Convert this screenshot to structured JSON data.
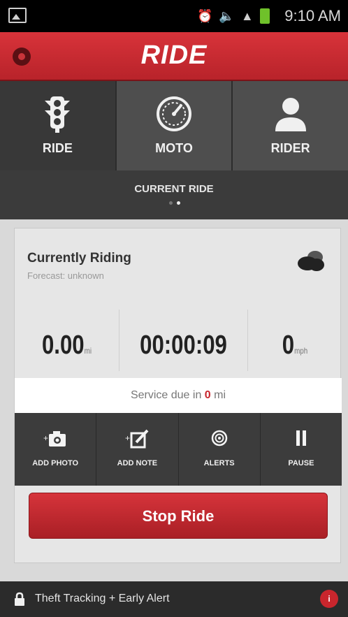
{
  "status_bar": {
    "time": "9:10 AM"
  },
  "app_bar": {
    "title": "RIDE"
  },
  "tabs": [
    {
      "label": "RIDE",
      "icon": "traffic-light-icon",
      "active": true
    },
    {
      "label": "MOTO",
      "icon": "speedometer-icon",
      "active": false
    },
    {
      "label": "RIDER",
      "icon": "person-icon",
      "active": false
    }
  ],
  "subheader": {
    "title": "CURRENT RIDE"
  },
  "ride_card": {
    "title": "Currently Riding",
    "subtitle": "Forecast: unknown",
    "stats": [
      {
        "value": "0.00",
        "unit": "mi"
      },
      {
        "value": "00:00:09",
        "unit": ""
      },
      {
        "value": "0",
        "unit": "mph"
      }
    ],
    "service": {
      "prefix": "Service due in",
      "value": "0",
      "unit": "mi"
    }
  },
  "actions": [
    {
      "label": "ADD PHOTO",
      "icon": "camera-icon"
    },
    {
      "label": "ADD NOTE",
      "icon": "note-icon"
    },
    {
      "label": "ALERTS",
      "icon": "alert-target-icon"
    },
    {
      "label": "PAUSE",
      "icon": "pause-icon"
    }
  ],
  "stop_button": {
    "label": "Stop Ride"
  },
  "footer": {
    "text": "Theft Tracking + Early Alert",
    "badge": "i"
  },
  "colors": {
    "accent": "#c8262d",
    "dark": "#3c3c3c"
  }
}
